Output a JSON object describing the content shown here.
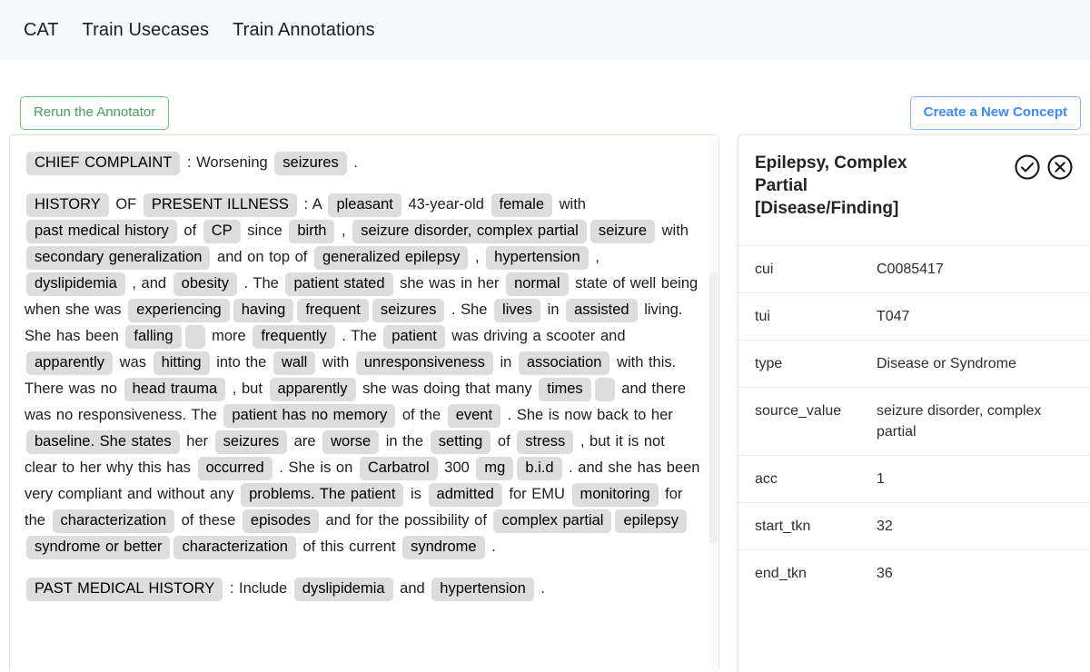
{
  "navbar": {
    "brand": "CAT",
    "links": [
      {
        "label": "Train Usecases"
      },
      {
        "label": "Train Annotations"
      }
    ]
  },
  "toolbar": {
    "rerun_label": "Rerun the Annotator",
    "create_concept_label": "Create a New Concept"
  },
  "colors": {
    "nav_bg": "#f7f8fa",
    "rerun_green": "#47a161",
    "create_blue": "#3d8bfd",
    "chip_bg": "#dddddd",
    "doc_border": "#e6dfd4"
  },
  "document": {
    "paragraphs": [
      {
        "tokens": [
          {
            "t": "chip",
            "v": "CHIEF COMPLAINT"
          },
          {
            "t": "plain",
            "v": ": Worsening "
          },
          {
            "t": "chip",
            "v": "seizures"
          },
          {
            "t": "plain",
            "v": "."
          }
        ]
      },
      {
        "tokens": [
          {
            "t": "chip",
            "v": "HISTORY"
          },
          {
            "t": "plain",
            "v": "OF"
          },
          {
            "t": "chip",
            "v": "PRESENT ILLNESS"
          },
          {
            "t": "plain",
            "v": ": A"
          },
          {
            "t": "chip",
            "v": "pleasant"
          },
          {
            "t": "plain",
            "v": "43-year-old"
          },
          {
            "t": "chip",
            "v": "female"
          },
          {
            "t": "plain",
            "v": "with"
          },
          {
            "t": "chip",
            "v": "past medical history"
          },
          {
            "t": "plain",
            "v": "of"
          },
          {
            "t": "chip",
            "v": "CP"
          },
          {
            "t": "plain",
            "v": "since"
          },
          {
            "t": "chip",
            "v": "birth"
          },
          {
            "t": "plain",
            "v": ","
          },
          {
            "t": "chip",
            "v": "seizure disorder, complex partial"
          },
          {
            "t": "chip",
            "v": "seizure"
          },
          {
            "t": "plain",
            "v": "with"
          },
          {
            "t": "chip",
            "v": "secondary generalization"
          },
          {
            "t": "plain",
            "v": "and on top of"
          },
          {
            "t": "chip",
            "v": "generalized epilepsy"
          },
          {
            "t": "plain",
            "v": ","
          },
          {
            "t": "chip",
            "v": "hypertension"
          },
          {
            "t": "plain",
            "v": ","
          },
          {
            "t": "chip",
            "v": "dyslipidemia"
          },
          {
            "t": "plain",
            "v": ", and"
          },
          {
            "t": "chip",
            "v": "obesity"
          },
          {
            "t": "plain",
            "v": ". The"
          },
          {
            "t": "chip",
            "v": "patient stated"
          },
          {
            "t": "plain",
            "v": "she was in her"
          },
          {
            "t": "chip",
            "v": "normal"
          },
          {
            "t": "plain",
            "v": "state of well being when she was"
          },
          {
            "t": "chip",
            "v": "experiencing"
          },
          {
            "t": "chip",
            "v": "having"
          },
          {
            "t": "chip",
            "v": "frequent"
          },
          {
            "t": "chip",
            "v": "seizures"
          },
          {
            "t": "plain",
            "v": ". She"
          },
          {
            "t": "chip",
            "v": "lives"
          },
          {
            "t": "plain",
            "v": "in"
          },
          {
            "t": "chip",
            "v": "assisted"
          },
          {
            "t": "plain",
            "v": "living. She has been"
          },
          {
            "t": "chip",
            "v": "falling"
          },
          {
            "t": "chip",
            "v": ""
          },
          {
            "t": "plain",
            "v": "more"
          },
          {
            "t": "chip",
            "v": "frequently"
          },
          {
            "t": "plain",
            "v": ". The"
          },
          {
            "t": "chip",
            "v": "patient"
          },
          {
            "t": "plain",
            "v": "was driving a scooter and"
          },
          {
            "t": "chip",
            "v": "apparently"
          },
          {
            "t": "plain",
            "v": "was"
          },
          {
            "t": "chip",
            "v": "hitting"
          },
          {
            "t": "plain",
            "v": "into the"
          },
          {
            "t": "chip",
            "v": "wall"
          },
          {
            "t": "plain",
            "v": "with"
          },
          {
            "t": "chip",
            "v": "unresponsiveness"
          },
          {
            "t": "plain",
            "v": "in"
          },
          {
            "t": "chip",
            "v": "association"
          },
          {
            "t": "plain",
            "v": "with this. There was no"
          },
          {
            "t": "chip",
            "v": "head trauma"
          },
          {
            "t": "plain",
            "v": ", but"
          },
          {
            "t": "chip",
            "v": "apparently"
          },
          {
            "t": "plain",
            "v": "she was doing that many"
          },
          {
            "t": "chip",
            "v": "times"
          },
          {
            "t": "chip",
            "v": ""
          },
          {
            "t": "plain",
            "v": "and there was no responsiveness. The"
          },
          {
            "t": "chip",
            "v": "patient has no memory"
          },
          {
            "t": "plain",
            "v": "of the"
          },
          {
            "t": "chip",
            "v": "event"
          },
          {
            "t": "plain",
            "v": ". She is now back to her"
          },
          {
            "t": "chip",
            "v": "baseline. She states"
          },
          {
            "t": "plain",
            "v": "her"
          },
          {
            "t": "chip",
            "v": "seizures"
          },
          {
            "t": "plain",
            "v": "are"
          },
          {
            "t": "chip",
            "v": "worse"
          },
          {
            "t": "plain",
            "v": "in the"
          },
          {
            "t": "chip",
            "v": "setting"
          },
          {
            "t": "plain",
            "v": "of"
          },
          {
            "t": "chip",
            "v": "stress"
          },
          {
            "t": "plain",
            "v": ", but it is not clear to her why this has"
          },
          {
            "t": "chip",
            "v": "occurred"
          },
          {
            "t": "plain",
            "v": ". She is on"
          },
          {
            "t": "chip",
            "v": "Carbatrol"
          },
          {
            "t": "plain",
            "v": "300"
          },
          {
            "t": "chip",
            "v": "mg"
          },
          {
            "t": "chip",
            "v": "b.i.d"
          },
          {
            "t": "plain",
            "v": ". and she has been very compliant and without any"
          },
          {
            "t": "chip",
            "v": "problems. The patient"
          },
          {
            "t": "plain",
            "v": "is"
          },
          {
            "t": "chip",
            "v": "admitted"
          },
          {
            "t": "plain",
            "v": "for EMU"
          },
          {
            "t": "chip",
            "v": "monitoring"
          },
          {
            "t": "plain",
            "v": "for the"
          },
          {
            "t": "chip",
            "v": "characterization"
          },
          {
            "t": "plain",
            "v": "of these"
          },
          {
            "t": "chip",
            "v": "episodes"
          },
          {
            "t": "plain",
            "v": "and for the possibility of"
          },
          {
            "t": "chip",
            "v": "complex partial"
          },
          {
            "t": "chip",
            "v": "epilepsy"
          },
          {
            "t": "chip",
            "v": "syndrome or better"
          },
          {
            "t": "chip",
            "v": "characterization"
          },
          {
            "t": "plain",
            "v": "of this current"
          },
          {
            "t": "chip",
            "v": "syndrome"
          },
          {
            "t": "plain",
            "v": "."
          }
        ]
      },
      {
        "tokens": [
          {
            "t": "chip",
            "v": "PAST MEDICAL HISTORY"
          },
          {
            "t": "plain",
            "v": ": Include"
          },
          {
            "t": "chip",
            "v": "dyslipidemia"
          },
          {
            "t": "plain",
            "v": "and"
          },
          {
            "t": "chip",
            "v": "hypertension"
          },
          {
            "t": "plain",
            "v": "."
          }
        ]
      }
    ]
  },
  "concept": {
    "title": "Epilepsy, Complex Partial\n[Disease/Finding]",
    "title_lines": [
      "Epilepsy, Complex",
      "Partial",
      "[Disease/Finding]"
    ],
    "accept_icon": "check-circle-icon",
    "reject_icon": "x-circle-icon",
    "rows": [
      {
        "key": "cui",
        "value": "C0085417"
      },
      {
        "key": "tui",
        "value": "T047"
      },
      {
        "key": "type",
        "value": "Disease or Syndrome"
      },
      {
        "key": "source_value",
        "value": "seizure disorder, complex partial"
      },
      {
        "key": "acc",
        "value": "1"
      },
      {
        "key": "start_tkn",
        "value": "32"
      },
      {
        "key": "end_tkn",
        "value": "36"
      }
    ]
  }
}
